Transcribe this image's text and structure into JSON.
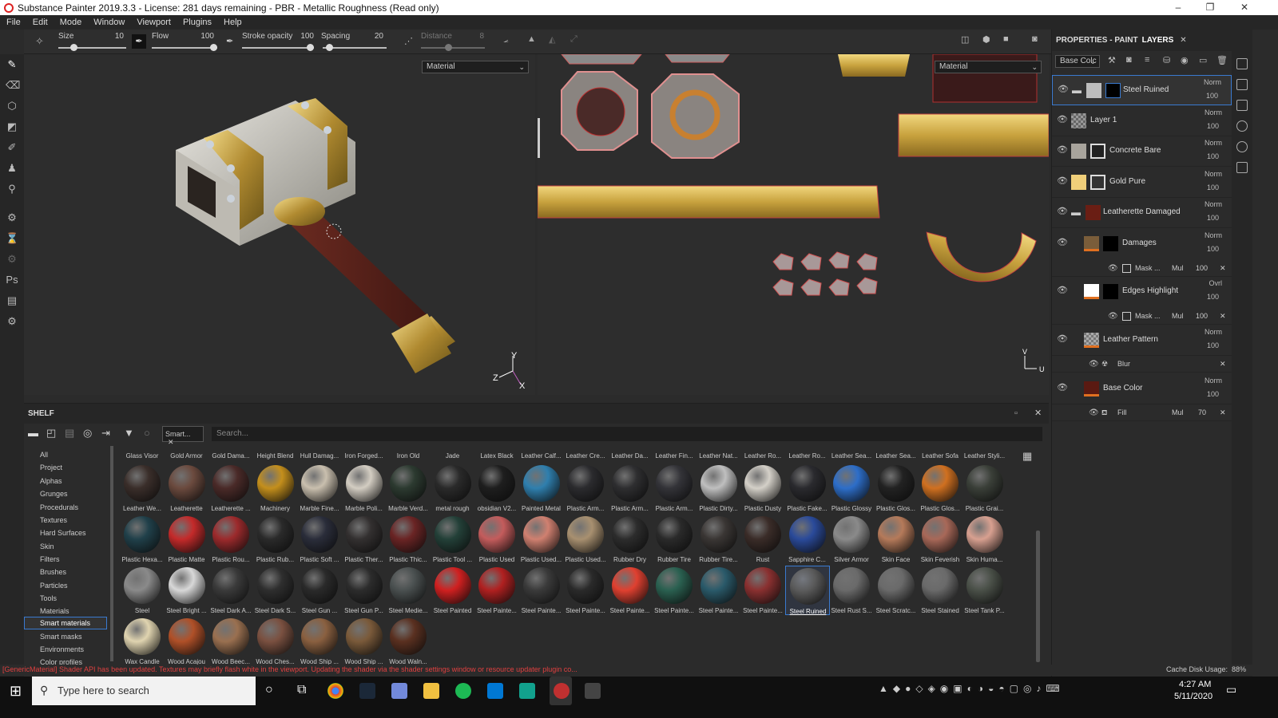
{
  "window": {
    "title": "Substance Painter 2019.3.3 - License: 281 days remaining - PBR - Metallic Roughness (Read only)",
    "minimize": "–",
    "maximize": "❐",
    "close": "✕"
  },
  "menu": [
    "File",
    "Edit",
    "Mode",
    "Window",
    "Viewport",
    "Plugins",
    "Help"
  ],
  "toolbar": {
    "size_label": "Size",
    "size_value": "10",
    "size_level": 0.2,
    "flow_label": "Flow",
    "flow_value": "100",
    "flow_level": 1.0,
    "stroke_label": "Stroke opacity",
    "stroke_value": "100",
    "stroke_level": 1.0,
    "spacing_label": "Spacing",
    "spacing_value": "20",
    "spacing_level": 0.05,
    "distance_label": "Distance",
    "distance_value": "8"
  },
  "viewport3d": {
    "dropdown": "Material"
  },
  "viewport2d": {
    "dropdown": "Material"
  },
  "axes3d": {
    "y": "Y",
    "z": "Z",
    "x": "X"
  },
  "axes2d": {
    "v": "V",
    "u": "U"
  },
  "right_panel": {
    "tab_properties": "PROPERTIES - PAINT",
    "tab_layers": "LAYERS",
    "channel": "Base Colc",
    "layers": [
      {
        "name": "Steel Ruined",
        "blend": "Norm",
        "opacity": "100",
        "color1": "#bdbdbd",
        "color2": "#000000",
        "selected": true
      },
      {
        "name": "Layer 1",
        "blend": "Norm",
        "opacity": "100",
        "color1": "#9a9a9a",
        "color2": ""
      },
      {
        "name": "Concrete Bare",
        "blend": "Norm",
        "opacity": "100",
        "color1": "#a8a49c",
        "color2": "#222222"
      },
      {
        "name": "Gold Pure",
        "blend": "Norm",
        "opacity": "100",
        "color1": "#f0cf7a",
        "color2": "#333333"
      },
      {
        "name": "Leatherette Damaged",
        "blend": "Norm",
        "opacity": "100",
        "color1": "#6a1e14",
        "color2": ""
      },
      {
        "name": "Damages",
        "blend": "Norm",
        "opacity": "100",
        "color1": "#7a5d3a",
        "color2": "#000000"
      },
      {
        "name": "Edges Highlight",
        "blend": "Ovrl",
        "opacity": "100",
        "color1": "#ffffff",
        "color2": "#000000"
      },
      {
        "name": "Leather Pattern",
        "blend": "Norm",
        "opacity": "100",
        "color1": "#aaaaaa",
        "color2": ""
      },
      {
        "name": "Base Color",
        "blend": "Norm",
        "opacity": "100",
        "color1": "#5a1a12",
        "color2": ""
      }
    ],
    "mask1": {
      "name": "Mask ...",
      "blend": "Mul",
      "opacity": "100"
    },
    "mask2": {
      "name": "Mask ...",
      "blend": "Mul",
      "opacity": "100"
    },
    "blur": {
      "name": "Blur"
    },
    "fill": {
      "name": "Fill",
      "blend": "Mul",
      "opacity": "70"
    }
  },
  "shelf": {
    "title": "SHELF",
    "filter_tag": "Smart...",
    "search_placeholder": "Search...",
    "categories": [
      "All",
      "Project",
      "Alphas",
      "Grunges",
      "Procedurals",
      "Textures",
      "Hard Surfaces",
      "Skin",
      "Filters",
      "Brushes",
      "Particles",
      "Tools",
      "Materials",
      "Smart materials",
      "Smart masks",
      "Environments",
      "Color profiles"
    ],
    "selected_category": "Smart materials",
    "top_row_labels": [
      "Glass Visor",
      "Gold Armor",
      "Gold Dama...",
      "Height Blend",
      "Hull Damag...",
      "Iron Forged...",
      "Iron Old",
      "Jade",
      "Latex Black",
      "Leather Calf...",
      "Leather Cre...",
      "Leather Da...",
      "Leather Fin...",
      "Leather Nat...",
      "Leather Ro...",
      "Leather Ro...",
      "Leather Sea...",
      "Leather Sea...",
      "Leather Sofa",
      "Leather Styli..."
    ],
    "rows": [
      {
        "labels": [
          "Leather We...",
          "Leatherette",
          "Leatherette ...",
          "Machinery",
          "Marble Fine...",
          "Marble Poli...",
          "Marble Verd...",
          "metal rough",
          "obsidian V2...",
          "Painted Metal",
          "Plastic Arm...",
          "Plastic Arm...",
          "Plastic Arm...",
          "Plastic Dirty...",
          "Plastic Dusty",
          "Plastic Fake...",
          "Plastic Glossy",
          "Plastic Glos...",
          "Plastic Glos...",
          "Plastic Grai..."
        ],
        "colors": [
          "#3a2e2a",
          "#6b4a3e",
          "#4a2a28",
          "#c48f1c",
          "#c9bfae",
          "#d3cdc2",
          "#2c3a30",
          "#2a2a2a",
          "#1e1e1e",
          "#2f7fae",
          "#2b2b2e",
          "#2e2e30",
          "#333338",
          "#bfbfbf",
          "#d4d0c8",
          "#2a2a2e",
          "#2d6ec9",
          "#222222",
          "#d07020",
          "#3a3f38"
        ]
      },
      {
        "labels": [
          "Plastic Hexa...",
          "Plastic Matte",
          "Plastic Rou...",
          "Plastic Rub...",
          "Plastic Soft ...",
          "Plastic Ther...",
          "Plastic Thic...",
          "Plastic Tool ...",
          "Plastic Used",
          "Plastic Used...",
          "Plastic Used...",
          "Rubber Dry",
          "Rubber Tire",
          "Rubber Tire...",
          "Rust",
          "Sapphire C...",
          "Silver Armor",
          "Skin Face",
          "Skin Feverish",
          "Skin Huma..."
        ],
        "colors": [
          "#20404a",
          "#c42a2a",
          "#9c2a2c",
          "#2a2a2a",
          "#2a2d3a",
          "#333030",
          "#6a2424",
          "#234038",
          "#c45c5c",
          "#d08070",
          "#a89070",
          "#2c2c2c",
          "#2a2a2a",
          "#3a3634",
          "#3a2c28",
          "#2a4a9a",
          "#8a8a8a",
          "#b57a5a",
          "#a86858",
          "#d8a090"
        ]
      },
      {
        "labels": [
          "Steel",
          "Steel Bright ...",
          "Steel Dark A...",
          "Steel Dark S...",
          "Steel Gun ...",
          "Steel Gun P...",
          "Steel Medie...",
          "Steel Painted",
          "Steel Painte...",
          "Steel Painte...",
          "Steel Painte...",
          "Steel Painte...",
          "Steel Painte...",
          "Steel Painte...",
          "Steel Painte...",
          "Steel Ruined",
          "Steel Rust S...",
          "Steel Scratc...",
          "Steel Stained",
          "Steel Tank P..."
        ],
        "colors": [
          "#8a8a8a",
          "#d8d8d8",
          "#3a3a3a",
          "#2e2e2e",
          "#2a2a2a",
          "#2c2c2c",
          "#4a5050",
          "#d02020",
          "#b02020",
          "#3a3a3a",
          "#2a2a2a",
          "#e04030",
          "#2a6050",
          "#2a5a6a",
          "#8a3030",
          "#5a5a5a",
          "#6a6a6a",
          "#6a6a6a",
          "#6a6a6a",
          "#4a5048"
        ]
      },
      {
        "labels": [
          "Wax Candle",
          "Wood Acajou",
          "Wood Beec...",
          "Wood Ches...",
          "Wood Ship ...",
          "Wood Ship ...",
          "Wood Waln..."
        ],
        "colors": [
          "#e0d4b0",
          "#b05028",
          "#9a7050",
          "#7a5040",
          "#8a6040",
          "#7a5a3a",
          "#5a3020"
        ]
      }
    ],
    "selected_item": "Steel Ruined"
  },
  "status": {
    "message": "[GenericMaterial] Shader API has been updated. Textures may briefly flash white in the viewport. Updating the shader via the shader settings window or resource updater plugin co...",
    "cache": "Cache Disk Usage:",
    "cache_value": "88%"
  },
  "taskbar": {
    "search_placeholder": "Type here to search",
    "time": "4:27 AM",
    "date": "5/11/2020"
  }
}
